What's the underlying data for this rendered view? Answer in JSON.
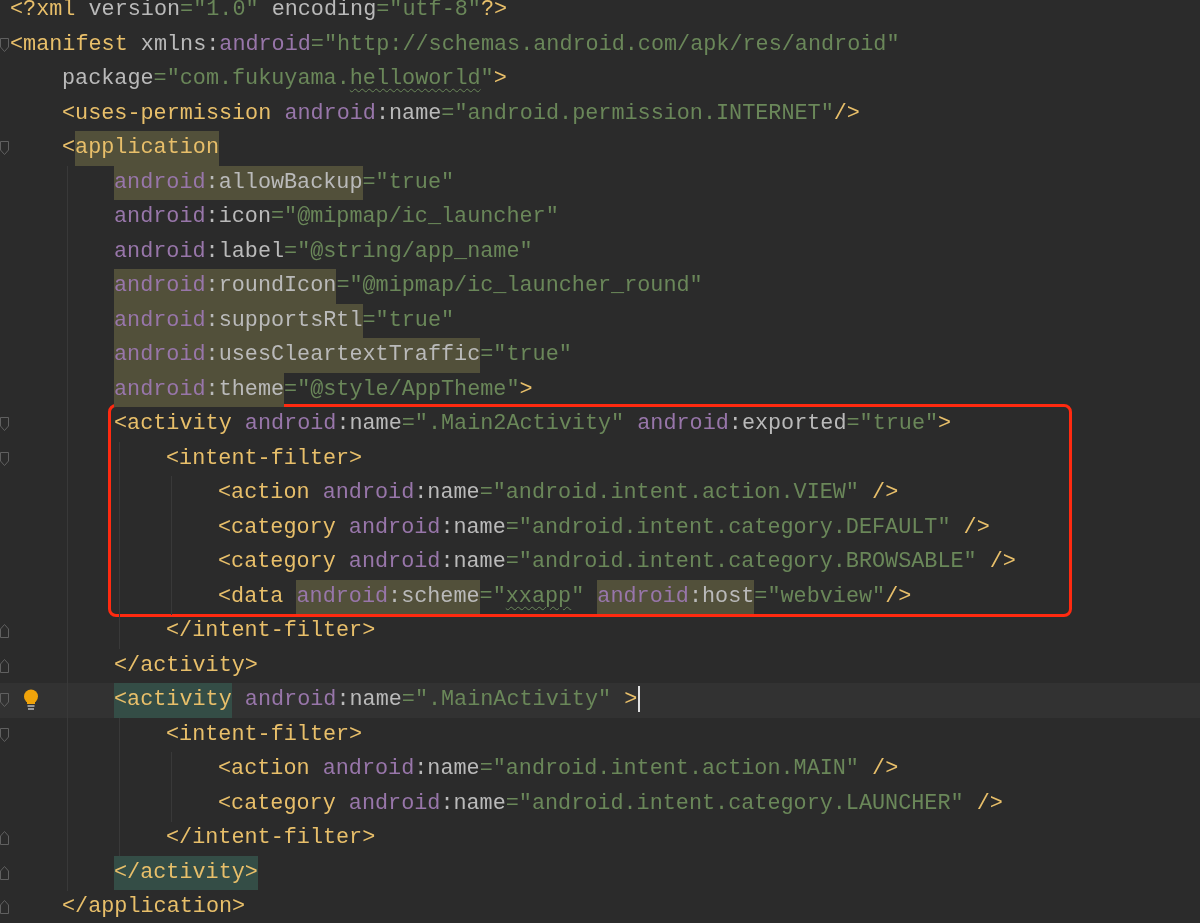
{
  "lines": [
    {
      "fold_start": false,
      "fold_end": false,
      "bulb": false,
      "current": false,
      "boxed": false,
      "tokens": [
        {
          "text": "<?xml",
          "kind": "tag"
        },
        {
          "text": " version",
          "kind": "attr"
        },
        {
          "text": "=\"1.0\"",
          "kind": "value"
        },
        {
          "text": " encoding",
          "kind": "attr"
        },
        {
          "text": "=\"utf-8\"",
          "kind": "value"
        },
        {
          "text": "?>",
          "kind": "tag"
        }
      ]
    },
    {
      "fold_start": true,
      "fold_end": false,
      "bulb": false,
      "current": false,
      "boxed": false,
      "tokens": [
        {
          "text": "<manifest ",
          "kind": "tag"
        },
        {
          "text": "xmlns:",
          "kind": "attr"
        },
        {
          "text": "android",
          "kind": "ns"
        },
        {
          "text": "=\"http://schemas.android.com/apk/res/android\"",
          "kind": "value"
        }
      ],
      "children": [
        {
          "fold_start": false,
          "fold_end": false,
          "bulb": false,
          "current": false,
          "boxed": false,
          "tokens": [
            {
              "text": "package",
              "kind": "attr"
            },
            {
              "text": "=\"com.fukuyama.",
              "kind": "value"
            },
            {
              "text": "helloworld",
              "kind": "value-squiggle"
            },
            {
              "text": "\"",
              "kind": "value"
            },
            {
              "text": ">",
              "kind": "tag"
            }
          ]
        },
        {
          "fold_start": false,
          "fold_end": false,
          "bulb": false,
          "current": false,
          "boxed": false,
          "tokens": [
            {
              "text": "<uses-permission ",
              "kind": "tag"
            },
            {
              "text": "android",
              "kind": "ns"
            },
            {
              "text": ":name",
              "kind": "attr"
            },
            {
              "text": "=\"android.permission.INTERNET\"",
              "kind": "value"
            },
            {
              "text": "/>",
              "kind": "tag"
            }
          ]
        },
        {
          "fold_start": true,
          "fold_end": false,
          "bulb": false,
          "current": false,
          "boxed": false,
          "tokens": [
            {
              "text": "<",
              "kind": "tag"
            },
            {
              "text": "application",
              "kind": "tag-warn"
            }
          ],
          "children": [
            {
              "fold_start": false,
              "fold_end": false,
              "bulb": false,
              "current": false,
              "boxed": false,
              "tokens": [
                {
                  "text": "android",
                  "kind": "ns-warn"
                },
                {
                  "text": ":allowBackup",
                  "kind": "attr-warn"
                },
                {
                  "text": "=\"true\"",
                  "kind": "value"
                }
              ]
            },
            {
              "fold_start": false,
              "fold_end": false,
              "bulb": false,
              "current": false,
              "boxed": false,
              "tokens": [
                {
                  "text": "android",
                  "kind": "ns"
                },
                {
                  "text": ":icon",
                  "kind": "attr"
                },
                {
                  "text": "=\"@mipmap/ic_launcher\"",
                  "kind": "value"
                }
              ]
            },
            {
              "fold_start": false,
              "fold_end": false,
              "bulb": false,
              "current": false,
              "boxed": false,
              "tokens": [
                {
                  "text": "android",
                  "kind": "ns"
                },
                {
                  "text": ":label",
                  "kind": "attr"
                },
                {
                  "text": "=\"@string/app_name\"",
                  "kind": "value"
                }
              ]
            },
            {
              "fold_start": false,
              "fold_end": false,
              "bulb": false,
              "current": false,
              "boxed": false,
              "tokens": [
                {
                  "text": "android",
                  "kind": "ns-warn"
                },
                {
                  "text": ":roundIcon",
                  "kind": "attr-warn"
                },
                {
                  "text": "=\"@mipmap/ic_launcher_round\"",
                  "kind": "value"
                }
              ]
            },
            {
              "fold_start": false,
              "fold_end": false,
              "bulb": false,
              "current": false,
              "boxed": false,
              "tokens": [
                {
                  "text": "android",
                  "kind": "ns-warn"
                },
                {
                  "text": ":supportsRtl",
                  "kind": "attr-warn"
                },
                {
                  "text": "=\"true\"",
                  "kind": "value"
                }
              ]
            },
            {
              "fold_start": false,
              "fold_end": false,
              "bulb": false,
              "current": false,
              "boxed": false,
              "tokens": [
                {
                  "text": "android",
                  "kind": "ns-warn"
                },
                {
                  "text": ":usesCleartextTraffic",
                  "kind": "attr-warn"
                },
                {
                  "text": "=\"true\"",
                  "kind": "value"
                }
              ]
            },
            {
              "fold_start": false,
              "fold_end": false,
              "bulb": false,
              "current": false,
              "boxed": false,
              "tokens": [
                {
                  "text": "android",
                  "kind": "ns-warn"
                },
                {
                  "text": ":theme",
                  "kind": "attr-warn"
                },
                {
                  "text": "=\"@style/AppTheme\"",
                  "kind": "value"
                },
                {
                  "text": ">",
                  "kind": "tag"
                }
              ]
            },
            {
              "fold_start": true,
              "fold_end": false,
              "bulb": false,
              "current": false,
              "boxed": true,
              "tokens": [
                {
                  "text": "<activity ",
                  "kind": "tag"
                },
                {
                  "text": "android",
                  "kind": "ns"
                },
                {
                  "text": ":name",
                  "kind": "attr"
                },
                {
                  "text": "=\".Main2Activity\" ",
                  "kind": "value"
                },
                {
                  "text": "android",
                  "kind": "ns"
                },
                {
                  "text": ":exported",
                  "kind": "attr"
                },
                {
                  "text": "=\"true\"",
                  "kind": "value"
                },
                {
                  "text": ">",
                  "kind": "tag"
                }
              ],
              "children": [
                {
                  "fold_start": true,
                  "fold_end": false,
                  "bulb": false,
                  "current": false,
                  "boxed": true,
                  "tokens": [
                    {
                      "text": "<intent-filter>",
                      "kind": "tag"
                    }
                  ],
                  "children": [
                    {
                      "fold_start": false,
                      "fold_end": false,
                      "bulb": false,
                      "current": false,
                      "boxed": true,
                      "tokens": [
                        {
                          "text": "<action ",
                          "kind": "tag"
                        },
                        {
                          "text": "android",
                          "kind": "ns"
                        },
                        {
                          "text": ":name",
                          "kind": "attr"
                        },
                        {
                          "text": "=\"android.intent.action.VIEW\" ",
                          "kind": "value"
                        },
                        {
                          "text": "/>",
                          "kind": "tag"
                        }
                      ]
                    },
                    {
                      "fold_start": false,
                      "fold_end": false,
                      "bulb": false,
                      "current": false,
                      "boxed": true,
                      "tokens": [
                        {
                          "text": "<category ",
                          "kind": "tag"
                        },
                        {
                          "text": "android",
                          "kind": "ns"
                        },
                        {
                          "text": ":name",
                          "kind": "attr"
                        },
                        {
                          "text": "=\"android.intent.category.DEFAULT\" ",
                          "kind": "value"
                        },
                        {
                          "text": "/>",
                          "kind": "tag"
                        }
                      ]
                    },
                    {
                      "fold_start": false,
                      "fold_end": false,
                      "bulb": false,
                      "current": false,
                      "boxed": true,
                      "tokens": [
                        {
                          "text": "<category ",
                          "kind": "tag"
                        },
                        {
                          "text": "android",
                          "kind": "ns"
                        },
                        {
                          "text": ":name",
                          "kind": "attr"
                        },
                        {
                          "text": "=\"android.intent.category.BROWSABLE\" ",
                          "kind": "value"
                        },
                        {
                          "text": "/>",
                          "kind": "tag"
                        }
                      ]
                    },
                    {
                      "fold_start": false,
                      "fold_end": false,
                      "bulb": false,
                      "current": false,
                      "boxed": true,
                      "tokens": [
                        {
                          "text": "<data ",
                          "kind": "tag"
                        },
                        {
                          "text": "android",
                          "kind": "ns-warn"
                        },
                        {
                          "text": ":scheme",
                          "kind": "attr-warn"
                        },
                        {
                          "text": "=\"",
                          "kind": "value"
                        },
                        {
                          "text": "xxapp",
                          "kind": "value-squiggle"
                        },
                        {
                          "text": "\" ",
                          "kind": "value"
                        },
                        {
                          "text": "android",
                          "kind": "ns-warn"
                        },
                        {
                          "text": ":host",
                          "kind": "attr-warn"
                        },
                        {
                          "text": "=\"webview\"",
                          "kind": "value"
                        },
                        {
                          "text": "/>",
                          "kind": "tag"
                        }
                      ]
                    }
                  ]
                },
                {
                  "fold_start": false,
                  "fold_end": true,
                  "bulb": false,
                  "current": false,
                  "boxed": false,
                  "tokens": [
                    {
                      "text": "</intent-filter>",
                      "kind": "tag"
                    }
                  ]
                }
              ]
            },
            {
              "fold_start": false,
              "fold_end": true,
              "bulb": false,
              "current": false,
              "boxed": false,
              "tokens": [
                {
                  "text": "</activity>",
                  "kind": "tag"
                }
              ]
            },
            {
              "fold_start": true,
              "fold_end": false,
              "bulb": true,
              "current": true,
              "boxed": false,
              "tokens": [
                {
                  "text": "<activity",
                  "kind": "tag-match"
                },
                {
                  "text": " android",
                  "kind": "ns"
                },
                {
                  "text": ":name",
                  "kind": "attr"
                },
                {
                  "text": "=\".MainActivity\" ",
                  "kind": "value"
                },
                {
                  "text": ">",
                  "kind": "tag"
                }
              ],
              "children": [
                {
                  "fold_start": true,
                  "fold_end": false,
                  "bulb": false,
                  "current": false,
                  "boxed": false,
                  "tokens": [
                    {
                      "text": "<intent-filter>",
                      "kind": "tag"
                    }
                  ],
                  "children": [
                    {
                      "fold_start": false,
                      "fold_end": false,
                      "bulb": false,
                      "current": false,
                      "boxed": false,
                      "tokens": [
                        {
                          "text": "<action ",
                          "kind": "tag"
                        },
                        {
                          "text": "android",
                          "kind": "ns"
                        },
                        {
                          "text": ":name",
                          "kind": "attr"
                        },
                        {
                          "text": "=\"android.intent.action.MAIN\" ",
                          "kind": "value"
                        },
                        {
                          "text": "/>",
                          "kind": "tag"
                        }
                      ]
                    },
                    {
                      "fold_start": false,
                      "fold_end": false,
                      "bulb": false,
                      "current": false,
                      "boxed": false,
                      "tokens": [
                        {
                          "text": "<category ",
                          "kind": "tag"
                        },
                        {
                          "text": "android",
                          "kind": "ns"
                        },
                        {
                          "text": ":name",
                          "kind": "attr"
                        },
                        {
                          "text": "=\"android.intent.category.LAUNCHER\" ",
                          "kind": "value"
                        },
                        {
                          "text": "/>",
                          "kind": "tag"
                        }
                      ]
                    }
                  ]
                },
                {
                  "fold_start": false,
                  "fold_end": true,
                  "bulb": false,
                  "current": false,
                  "boxed": false,
                  "tokens": [
                    {
                      "text": "</intent-filter>",
                      "kind": "tag"
                    }
                  ]
                }
              ]
            },
            {
              "fold_start": false,
              "fold_end": true,
              "bulb": false,
              "current": false,
              "boxed": false,
              "tokens": [
                {
                  "text": "</activity>",
                  "kind": "tag-match"
                }
              ]
            }
          ]
        },
        {
          "fold_start": false,
          "fold_end": true,
          "bulb": false,
          "current": false,
          "boxed": false,
          "tokens": [
            {
              "text": "</application>",
              "kind": "tag"
            }
          ]
        }
      ]
    }
  ]
}
